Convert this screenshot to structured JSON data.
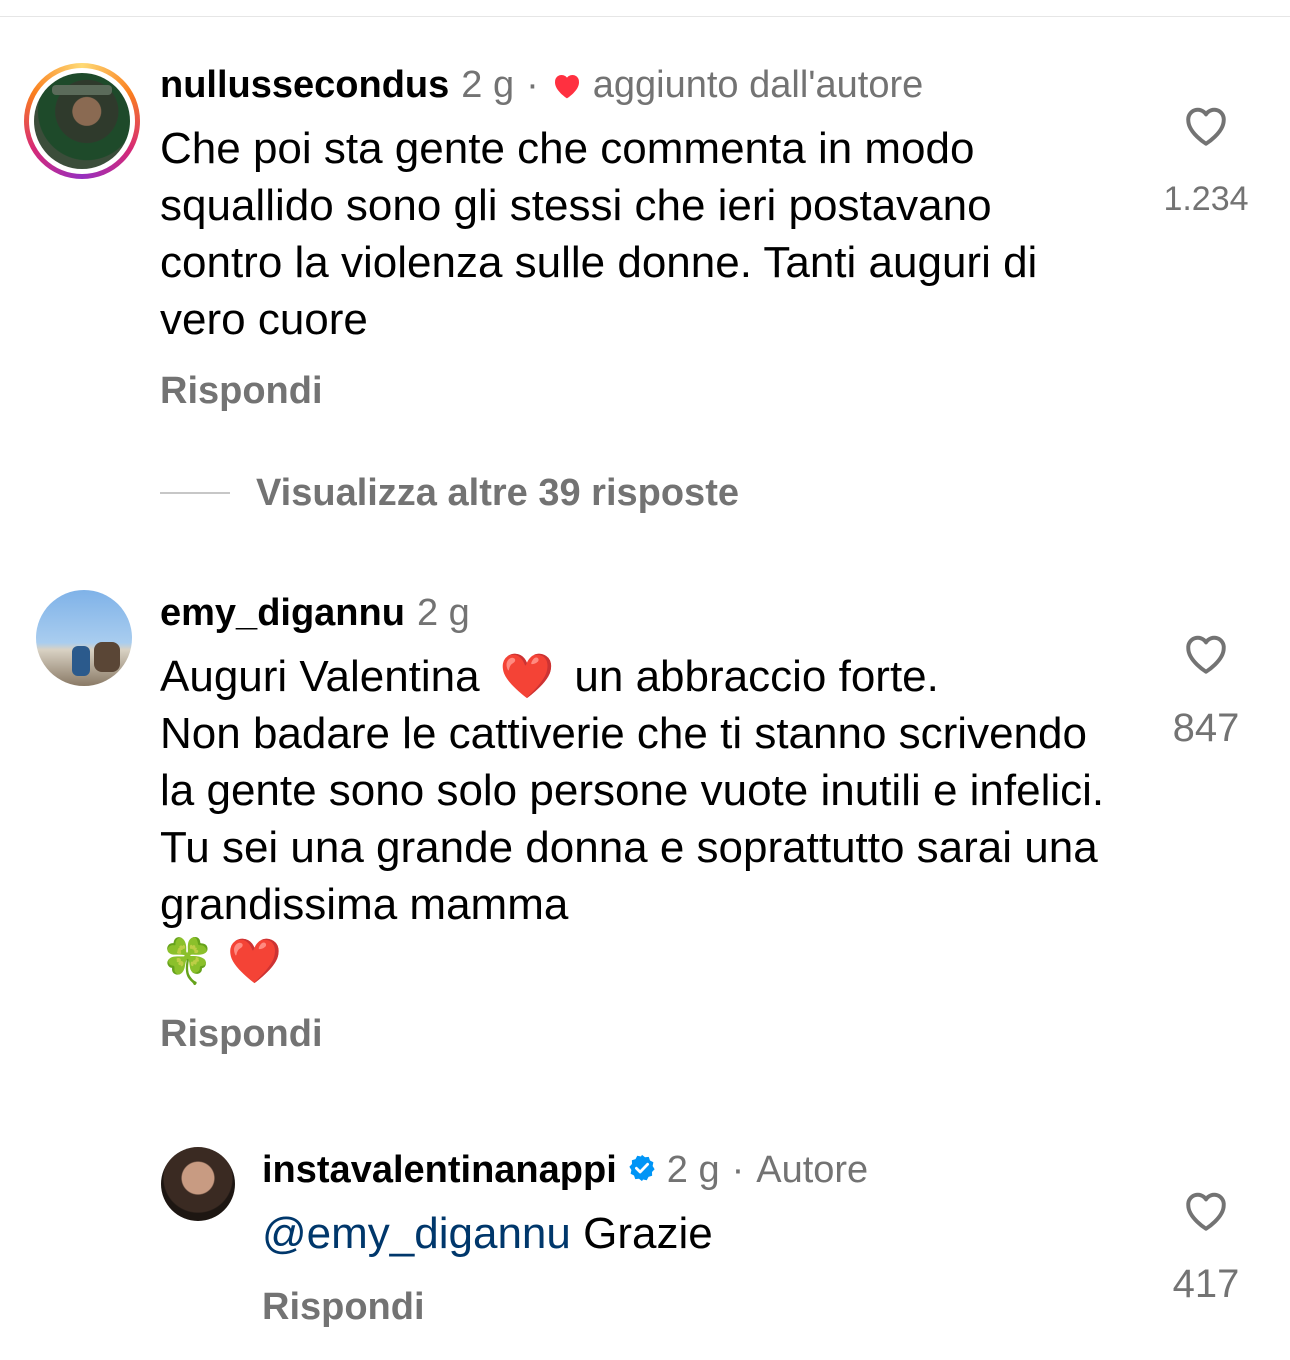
{
  "comments": [
    {
      "username": "nullussecondus",
      "time": "2 g",
      "separator": "·",
      "liked_by_author_label": "aggiunto dall'autore",
      "text": "Che poi sta gente che commenta in modo squallido  sono gli stessi che ieri postavano contro la violenza sulle donne. Tanti auguri di vero cuore",
      "like_count": "1.234",
      "reply_label": "Rispondi"
    },
    {
      "username": "emy_digannu",
      "time": "2 g",
      "text_line1a": "Auguri Valentina",
      "text_emoji1": "❤️",
      "text_line1b": "un abbraccio forte.",
      "text_rest": "Non badare le cattiverie che ti stanno scrivendo la gente sono solo persone vuote inutili e infelici. Tu sei una grande donna e soprattutto sarai una grandissima mamma",
      "text_emoji2": "🍀 ❤️",
      "like_count": "847",
      "reply_label": "Rispondi"
    }
  ],
  "view_more_replies": "Visualizza altre 39 risposte",
  "reply": {
    "username": "instavalentinanappi",
    "time": "2 g",
    "separator": "·",
    "author_label": "Autore",
    "mention": "@emy_digannu",
    "text": "Grazie",
    "like_count": "417",
    "reply_label": "Rispondi"
  },
  "colors": {
    "secondary_text": "#737373",
    "mention": "#00376b",
    "heart_red": "#ff3040",
    "verified_blue": "#0095f6"
  },
  "icons": [
    "heart-outline-icon",
    "heart-filled-icon",
    "verified-badge-icon"
  ]
}
